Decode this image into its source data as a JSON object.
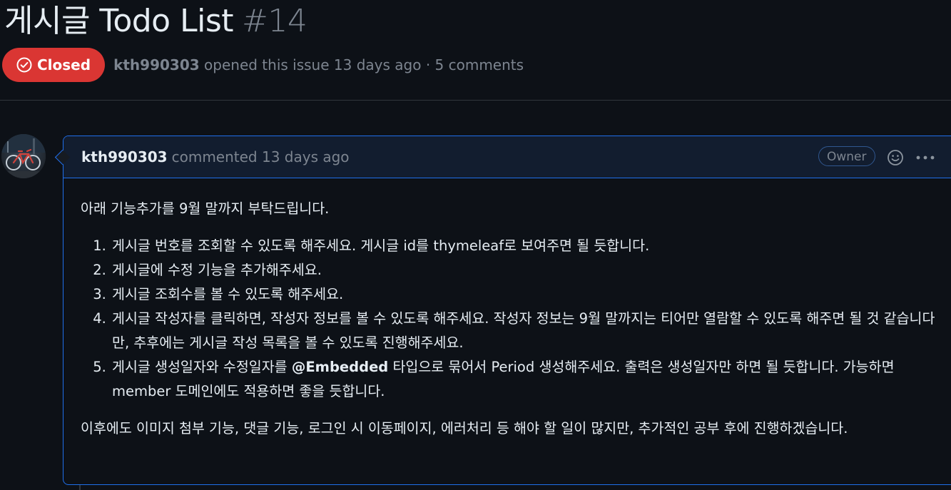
{
  "issue": {
    "title": "게시글 Todo List",
    "number": "#14",
    "state": "Closed",
    "author": "kth990303",
    "opened_text": "opened this issue 13 days ago",
    "separator": "·",
    "comments_count": "5 comments"
  },
  "comment": {
    "author": "kth990303",
    "action": "commented 13 days ago",
    "role_badge": "Owner",
    "intro": "아래 기능추가를 9월 말까지 부탁드립니다.",
    "items": [
      {
        "text": "게시글 번호를 조회할 수 있도록 해주세요. 게시글 id를 thymeleaf로 보여주면 될 듯합니다."
      },
      {
        "text": "게시글에 수정 기능을 추가해주세요."
      },
      {
        "text": "게시글 조회수를 볼 수 있도록 해주세요."
      },
      {
        "text": "게시글 작성자를 클릭하면, 작성자 정보를 볼 수 있도록 해주세요. 작성자 정보는 9월 말까지는 티어만 열람할 수 있도록 해주면 될 것 같습니다만, 추후에는 게시글 작성 목록을 볼 수 있도록 진행해주세요."
      },
      {
        "before": "게시글 생성일자와 수정일자를 ",
        "bold": "@Embedded",
        "after": " 타입으로 묶어서 Period 생성해주세요. 출력은 생성일자만 하면 될 듯합니다. 가능하면 member 도메인에도 적용하면 좋을 듯합니다."
      }
    ],
    "outro": "이후에도 이미지 첨부 기능, 댓글 기능, 로그인 시 이동페이지, 에러처리 등 해야 할 일이 많지만, 추가적인 공부 후에 진행하겠습니다."
  },
  "icons": {
    "state": "check-circle-icon",
    "reaction": "smiley-icon",
    "menu": "kebab-horizontal-icon",
    "avatar": "user-avatar-bicycle-photo"
  },
  "colors": {
    "background": "#0d1117",
    "closed_badge": "#da3633",
    "comment_border": "#1f6feb",
    "comment_header": "#121d2f",
    "muted_text": "#7d8590",
    "primary_text": "#e6edf3"
  }
}
